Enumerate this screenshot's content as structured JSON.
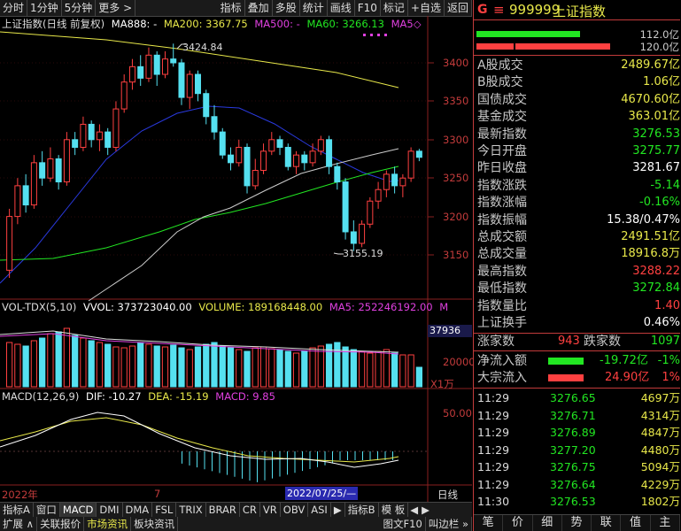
{
  "toolbar": {
    "items": [
      "分时",
      "1分钟",
      "5分钟",
      "更多 >",
      "指标",
      "叠加",
      "多股",
      "统计",
      "画线",
      "F10",
      "标记",
      "+自选",
      "返回"
    ]
  },
  "main_legend": {
    "title": "上证指数(日线 前复权)",
    "ma888": "MA888: -",
    "ma200": "MA200: 3367.75",
    "ma500": "MA500: -",
    "ma60": "MA60: 3266.13",
    "ma5": "MA5◇"
  },
  "price_axis": [
    "3400",
    "3350",
    "3300",
    "3250",
    "3200",
    "3150"
  ],
  "annotations": {
    "high": "3424.84",
    "low": "3155.19"
  },
  "vol_legend": {
    "title": "VOL-TDX(5,10)",
    "vvol": "VVOL: 373723040.00",
    "volume": "VOLUME: 189168448.00",
    "ma5": "MA5: 252246192.00",
    "m": "M"
  },
  "vol_axis": {
    "current": "37936",
    "tick": "20000",
    "unit": "X1万"
  },
  "macd_legend": {
    "title": "MACD(12,26,9)",
    "dif": "DIF: -10.27",
    "dea": "DEA: -15.19",
    "macd": "MACD: 9.85"
  },
  "macd_axis": {
    "tick": "50.00"
  },
  "date_axis": {
    "year": "2022年",
    "month": "7",
    "cursor": "2022/07/25/—",
    "period": "日线"
  },
  "indicator_tabs": [
    "指标A",
    "窗口",
    "MACD",
    "DMI",
    "DMA",
    "FSL",
    "TRIX",
    "BRAR",
    "CR",
    "VR",
    "OBV",
    "ASI",
    "▶",
    "指标B",
    "模 板"
  ],
  "bottom_tabs": [
    "扩展 ∧",
    "关联报价",
    "市场资讯",
    "板块资讯",
    "图文F10",
    "叫边栏 »"
  ],
  "panel": {
    "code": "999999",
    "name": "上证指数",
    "g": "G",
    "menu": "≡",
    "bar1_value": "112.0亿",
    "bar2_value": "120.0亿",
    "rows": [
      {
        "k": "A股成交",
        "v": "2489.67亿",
        "c": "y"
      },
      {
        "k": "B股成交",
        "v": "1.06亿",
        "c": "y"
      },
      {
        "k": "国债成交",
        "v": "4670.60亿",
        "c": "y"
      },
      {
        "k": "基金成交",
        "v": "363.01亿",
        "c": "y"
      },
      {
        "k": "最新指数",
        "v": "3276.53",
        "c": "g"
      },
      {
        "k": "今日开盘",
        "v": "3275.77",
        "c": "g"
      },
      {
        "k": "昨日收盘",
        "v": "3281.67",
        "c": "w"
      },
      {
        "k": "指数涨跌",
        "v": "-5.14",
        "c": "g"
      },
      {
        "k": "指数涨幅",
        "v": "-0.16%",
        "c": "g"
      },
      {
        "k": "指数振幅",
        "v": "15.38/0.47%",
        "c": "w"
      },
      {
        "k": "总成交额",
        "v": "2491.51亿",
        "c": "y"
      },
      {
        "k": "总成交量",
        "v": "18916.8万",
        "c": "y"
      },
      {
        "k": "最高指数",
        "v": "3288.22",
        "c": "r"
      },
      {
        "k": "最低指数",
        "v": "3272.84",
        "c": "g"
      },
      {
        "k": "指数量比",
        "v": "1.40",
        "c": "r"
      },
      {
        "k": "上证换手",
        "v": "0.46%",
        "c": "w"
      }
    ],
    "updown": {
      "up_label": "涨家数",
      "up": "943",
      "down_label": "跌家数",
      "down": "1097"
    },
    "flow": [
      {
        "k": "净流入额",
        "v": "-19.72亿",
        "pct": "-1%",
        "c": "g"
      },
      {
        "k": "大宗流入",
        "v": "24.90亿",
        "pct": "1%",
        "c": "r"
      }
    ],
    "ticks": [
      {
        "t": "11:29",
        "p": "3276.65",
        "v": "4697万"
      },
      {
        "t": "11:29",
        "p": "3276.71",
        "v": "4314万"
      },
      {
        "t": "11:29",
        "p": "3276.89",
        "v": "4847万"
      },
      {
        "t": "11:29",
        "p": "3277.20",
        "v": "4480万"
      },
      {
        "t": "11:29",
        "p": "3276.75",
        "v": "5094万"
      },
      {
        "t": "11:29",
        "p": "3276.64",
        "v": "4229万"
      },
      {
        "t": "11:30",
        "p": "3276.53",
        "v": "1802万"
      }
    ],
    "tabs": [
      "笔",
      "价",
      "细",
      "势",
      "联",
      "值",
      "主"
    ]
  },
  "colors": {
    "up": "#ff4040",
    "down": "#55e0f0",
    "yellow": "#e8e84a",
    "green": "#22e622",
    "magenta": "#e040e0",
    "blue": "#2a3ae0",
    "white": "#ffffff"
  }
}
